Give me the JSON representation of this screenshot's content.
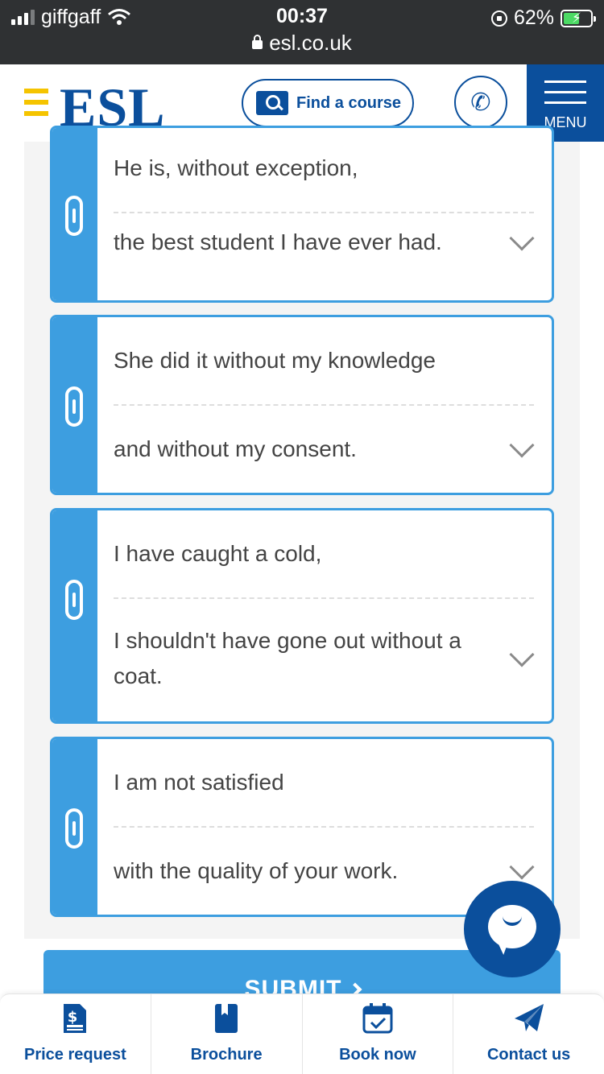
{
  "status_bar": {
    "carrier": "giffgaff",
    "time": "00:37",
    "url": "esl.co.uk",
    "battery": "62%"
  },
  "header": {
    "logo": "ESL",
    "find_course": "Find a course",
    "menu": "MENU"
  },
  "cards": [
    {
      "first": "He is, without exception,",
      "second": "the best student I have ever had."
    },
    {
      "first": "She did it without my knowledge",
      "second": "and without my consent."
    },
    {
      "first": "I have caught a cold,",
      "second": "I shouldn't have gone out without a coat."
    },
    {
      "first": "I am not satisfied",
      "second": "with the quality of your work."
    }
  ],
  "submit": {
    "label": "SUBMIT"
  },
  "bottom_nav": [
    {
      "label": "Price request",
      "icon": "price-request-icon"
    },
    {
      "label": "Brochure",
      "icon": "brochure-icon"
    },
    {
      "label": "Book now",
      "icon": "calendar-icon"
    },
    {
      "label": "Contact us",
      "icon": "paper-plane-icon"
    }
  ],
  "colors": {
    "brand_blue": "#0b4f9c",
    "accent_blue": "#3d9ee0",
    "brand_yellow": "#f5c400"
  }
}
